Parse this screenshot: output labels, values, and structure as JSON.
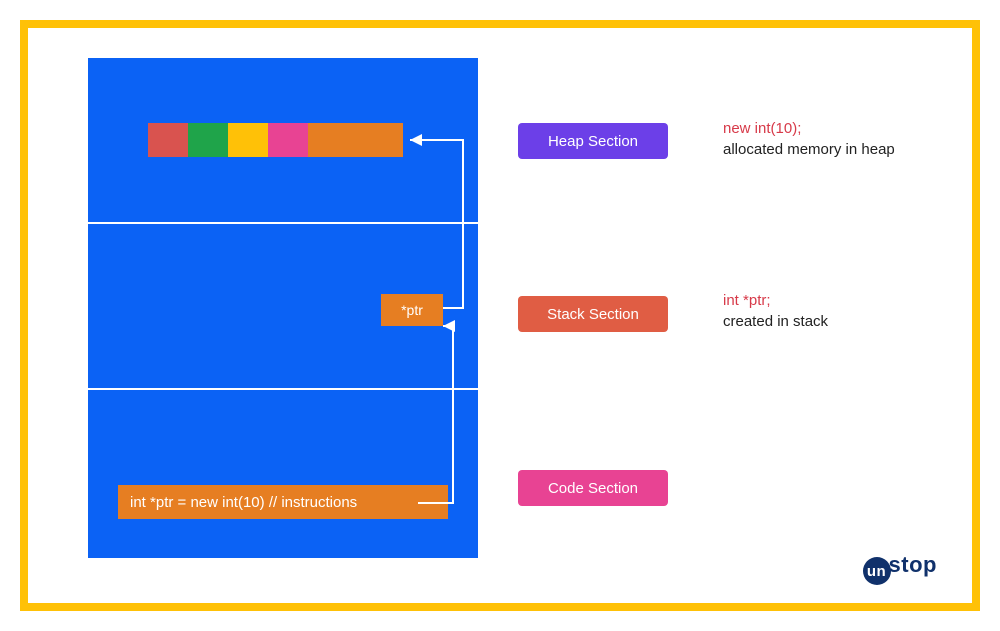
{
  "memory": {
    "heap": {
      "blocks": [
        "red",
        "green",
        "yellow",
        "pink",
        "orange"
      ]
    },
    "stack": {
      "ptr_label": "*ptr"
    },
    "code": {
      "instruction": "int *ptr = new int(10) // instructions"
    }
  },
  "labels": {
    "heap": "Heap Section",
    "stack": "Stack Section",
    "code": "Code Section"
  },
  "annotations": {
    "heap_code": "new int(10);",
    "heap_desc": "allocated memory in heap",
    "stack_code": "int *ptr;",
    "stack_desc": "created in stack"
  },
  "logo": {
    "prefix": "un",
    "suffix": "stop"
  }
}
